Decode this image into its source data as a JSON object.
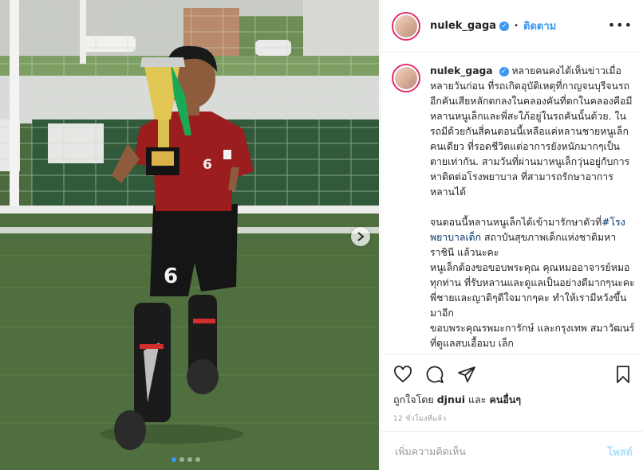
{
  "post": {
    "username": "nulek_gaga",
    "verified_mark": "✓",
    "follow_sep": "•",
    "follow_label": "ติดตาม",
    "more_label": "•••",
    "caption_text": "หลายคนคงได้เห็นข่าวเมื่อหลายวันก่อน ที่รถเกิดอุบัติเหตุที่กาญจนบุรีจนรถอีกคันเสียหลักตกลงในคลองคันที่ตกในคลองคือมีหลานหนูเล็กและพี่สะใภ้อยู่ในรถคันนั้นด้วย. ในรถมีด้วยกันสี่คนตอนนี้เหลือแค่หลานชายหนูเล็กคนเดียว ที่รอดชีวิตแต่อาการยังหนักมากๆเป็นตายเท่ากัน. สามวันที่ผ่านมาหนูเล็กวุ่นอยู่กับการหาติดต่อโรงพยาบาล ที่สามารถรักษาอาการหลานได้",
    "caption_text_2": "จนตอนนี้หลานหนูเล็กได้เข้ามารักษาตัวที่",
    "hashtag": "#โรงพยาบาลเด็ก",
    "caption_text_3": " สถาบันสุขภาพเด็กแห่งชาติมหาราชินี แล้วนะคะ\nหนูเล็กต้องขอขอบพระคุณ คุณหมออาจารย์หมอทุกท่าน ที่รับหลานและดูแลเป็นอย่างดีมากๆนะคะ พี่ชายและญาติๆดีใจมากๆคะ ทำให้เรามีหวังขึ้นมาอีก\nขอบพระคุณรพมะการักษ์ และกรุงเทพ สมาวัฒนร์ ที่ดูแลสบเอื้อมบ เล็ก",
    "liked_by_prefix": "ถูกใจโดย",
    "liked_by_user": "djnui",
    "liked_by_and": "และ",
    "liked_by_others": "คนอื่นๆ",
    "timestamp": "12 ชั่วโมงที่แล้ว",
    "comment_placeholder": "เพิ่มความคิดเห็น",
    "post_button": "โพสต์",
    "carousel_count": 4,
    "carousel_active": 0
  },
  "icons": {
    "like": "heart-icon",
    "comment": "comment-bubble-icon",
    "share": "paper-plane-icon",
    "save": "bookmark-icon",
    "next": "chevron-right-icon"
  },
  "colors": {
    "accent": "#3897f0",
    "post_disabled": "#b2dffc"
  }
}
